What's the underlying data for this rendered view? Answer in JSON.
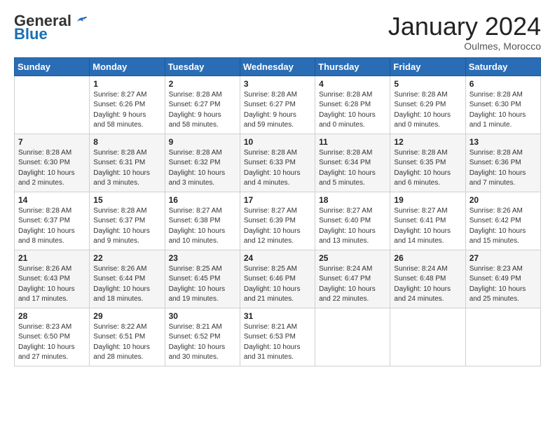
{
  "header": {
    "logo_general": "General",
    "logo_blue": "Blue",
    "month_title": "January 2024",
    "location": "Oulmes, Morocco"
  },
  "days_of_week": [
    "Sunday",
    "Monday",
    "Tuesday",
    "Wednesday",
    "Thursday",
    "Friday",
    "Saturday"
  ],
  "weeks": [
    [
      {
        "day": "",
        "content": ""
      },
      {
        "day": "1",
        "content": "Sunrise: 8:27 AM\nSunset: 6:26 PM\nDaylight: 9 hours\nand 58 minutes."
      },
      {
        "day": "2",
        "content": "Sunrise: 8:28 AM\nSunset: 6:27 PM\nDaylight: 9 hours\nand 58 minutes."
      },
      {
        "day": "3",
        "content": "Sunrise: 8:28 AM\nSunset: 6:27 PM\nDaylight: 9 hours\nand 59 minutes."
      },
      {
        "day": "4",
        "content": "Sunrise: 8:28 AM\nSunset: 6:28 PM\nDaylight: 10 hours\nand 0 minutes."
      },
      {
        "day": "5",
        "content": "Sunrise: 8:28 AM\nSunset: 6:29 PM\nDaylight: 10 hours\nand 0 minutes."
      },
      {
        "day": "6",
        "content": "Sunrise: 8:28 AM\nSunset: 6:30 PM\nDaylight: 10 hours\nand 1 minute."
      }
    ],
    [
      {
        "day": "7",
        "content": "Sunrise: 8:28 AM\nSunset: 6:30 PM\nDaylight: 10 hours\nand 2 minutes."
      },
      {
        "day": "8",
        "content": "Sunrise: 8:28 AM\nSunset: 6:31 PM\nDaylight: 10 hours\nand 3 minutes."
      },
      {
        "day": "9",
        "content": "Sunrise: 8:28 AM\nSunset: 6:32 PM\nDaylight: 10 hours\nand 3 minutes."
      },
      {
        "day": "10",
        "content": "Sunrise: 8:28 AM\nSunset: 6:33 PM\nDaylight: 10 hours\nand 4 minutes."
      },
      {
        "day": "11",
        "content": "Sunrise: 8:28 AM\nSunset: 6:34 PM\nDaylight: 10 hours\nand 5 minutes."
      },
      {
        "day": "12",
        "content": "Sunrise: 8:28 AM\nSunset: 6:35 PM\nDaylight: 10 hours\nand 6 minutes."
      },
      {
        "day": "13",
        "content": "Sunrise: 8:28 AM\nSunset: 6:36 PM\nDaylight: 10 hours\nand 7 minutes."
      }
    ],
    [
      {
        "day": "14",
        "content": "Sunrise: 8:28 AM\nSunset: 6:37 PM\nDaylight: 10 hours\nand 8 minutes."
      },
      {
        "day": "15",
        "content": "Sunrise: 8:28 AM\nSunset: 6:37 PM\nDaylight: 10 hours\nand 9 minutes."
      },
      {
        "day": "16",
        "content": "Sunrise: 8:27 AM\nSunset: 6:38 PM\nDaylight: 10 hours\nand 10 minutes."
      },
      {
        "day": "17",
        "content": "Sunrise: 8:27 AM\nSunset: 6:39 PM\nDaylight: 10 hours\nand 12 minutes."
      },
      {
        "day": "18",
        "content": "Sunrise: 8:27 AM\nSunset: 6:40 PM\nDaylight: 10 hours\nand 13 minutes."
      },
      {
        "day": "19",
        "content": "Sunrise: 8:27 AM\nSunset: 6:41 PM\nDaylight: 10 hours\nand 14 minutes."
      },
      {
        "day": "20",
        "content": "Sunrise: 8:26 AM\nSunset: 6:42 PM\nDaylight: 10 hours\nand 15 minutes."
      }
    ],
    [
      {
        "day": "21",
        "content": "Sunrise: 8:26 AM\nSunset: 6:43 PM\nDaylight: 10 hours\nand 17 minutes."
      },
      {
        "day": "22",
        "content": "Sunrise: 8:26 AM\nSunset: 6:44 PM\nDaylight: 10 hours\nand 18 minutes."
      },
      {
        "day": "23",
        "content": "Sunrise: 8:25 AM\nSunset: 6:45 PM\nDaylight: 10 hours\nand 19 minutes."
      },
      {
        "day": "24",
        "content": "Sunrise: 8:25 AM\nSunset: 6:46 PM\nDaylight: 10 hours\nand 21 minutes."
      },
      {
        "day": "25",
        "content": "Sunrise: 8:24 AM\nSunset: 6:47 PM\nDaylight: 10 hours\nand 22 minutes."
      },
      {
        "day": "26",
        "content": "Sunrise: 8:24 AM\nSunset: 6:48 PM\nDaylight: 10 hours\nand 24 minutes."
      },
      {
        "day": "27",
        "content": "Sunrise: 8:23 AM\nSunset: 6:49 PM\nDaylight: 10 hours\nand 25 minutes."
      }
    ],
    [
      {
        "day": "28",
        "content": "Sunrise: 8:23 AM\nSunset: 6:50 PM\nDaylight: 10 hours\nand 27 minutes."
      },
      {
        "day": "29",
        "content": "Sunrise: 8:22 AM\nSunset: 6:51 PM\nDaylight: 10 hours\nand 28 minutes."
      },
      {
        "day": "30",
        "content": "Sunrise: 8:21 AM\nSunset: 6:52 PM\nDaylight: 10 hours\nand 30 minutes."
      },
      {
        "day": "31",
        "content": "Sunrise: 8:21 AM\nSunset: 6:53 PM\nDaylight: 10 hours\nand 31 minutes."
      },
      {
        "day": "",
        "content": ""
      },
      {
        "day": "",
        "content": ""
      },
      {
        "day": "",
        "content": ""
      }
    ]
  ]
}
